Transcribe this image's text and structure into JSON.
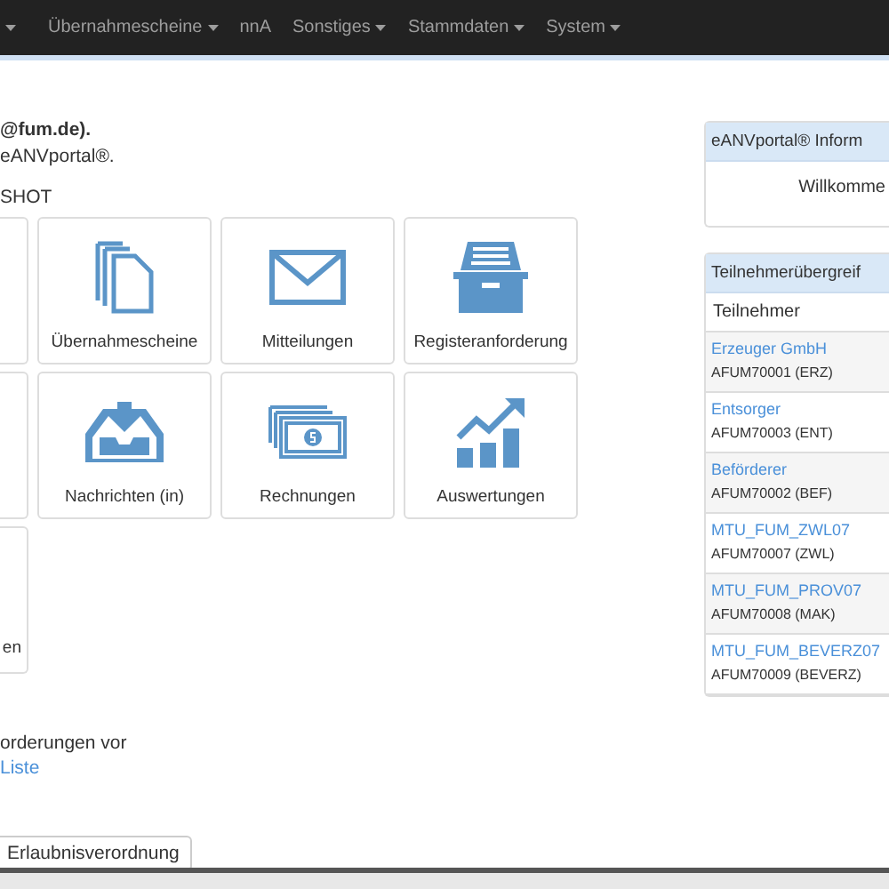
{
  "navbar": {
    "items": [
      {
        "dropdown": true
      },
      {
        "label": "Übernahmescheine",
        "dropdown": true
      },
      {
        "label": "nnA",
        "dropdown": false
      },
      {
        "label": "Sonstiges",
        "dropdown": true
      },
      {
        "label": "Stammdaten",
        "dropdown": true
      },
      {
        "label": "System",
        "dropdown": true
      }
    ]
  },
  "intro": {
    "user_line": "@fum.de).",
    "welcome_line": "eANVportal®.",
    "mode_line": "SHOT"
  },
  "tiles": [
    [
      {
        "kind": "cut"
      },
      {
        "kind": "documents",
        "label": "Übernahmescheine"
      },
      {
        "kind": "envelope",
        "label": "Mitteilungen"
      },
      {
        "kind": "drawer",
        "label": "Registeranforderung"
      }
    ],
    [
      {
        "kind": "cut"
      },
      {
        "kind": "inbox",
        "label": "Nachrichten (in)"
      },
      {
        "kind": "bills",
        "label": "Rechnungen"
      },
      {
        "kind": "chart",
        "label": "Auswertungen"
      }
    ],
    [
      {
        "kind": "cut",
        "label": "en"
      }
    ]
  ],
  "notice": {
    "text": "orderungen vor",
    "link": "Liste"
  },
  "buttons": [
    "Erlaubnisverordnung"
  ],
  "info_panel": {
    "title": "eANVportal® Inform",
    "body": "Willkomme"
  },
  "participants_panel": {
    "title": "Teilnehmerübergreif",
    "column": "Teilnehmer",
    "rows": [
      {
        "name": "Erzeuger GmbH",
        "id": "AFUM70001 (ERZ)"
      },
      {
        "name": "Entsorger",
        "id": "AFUM70003 (ENT)"
      },
      {
        "name": "Beförderer",
        "id": "AFUM70002 (BEF)"
      },
      {
        "name": "MTU_FUM_ZWL07",
        "id": "AFUM70007 (ZWL)"
      },
      {
        "name": "MTU_FUM_PROV07",
        "id": "AFUM70008 (MAK)"
      },
      {
        "name": "MTU_FUM_BEVERZ07",
        "id": "AFUM70009 (BEVERZ)"
      }
    ]
  }
}
